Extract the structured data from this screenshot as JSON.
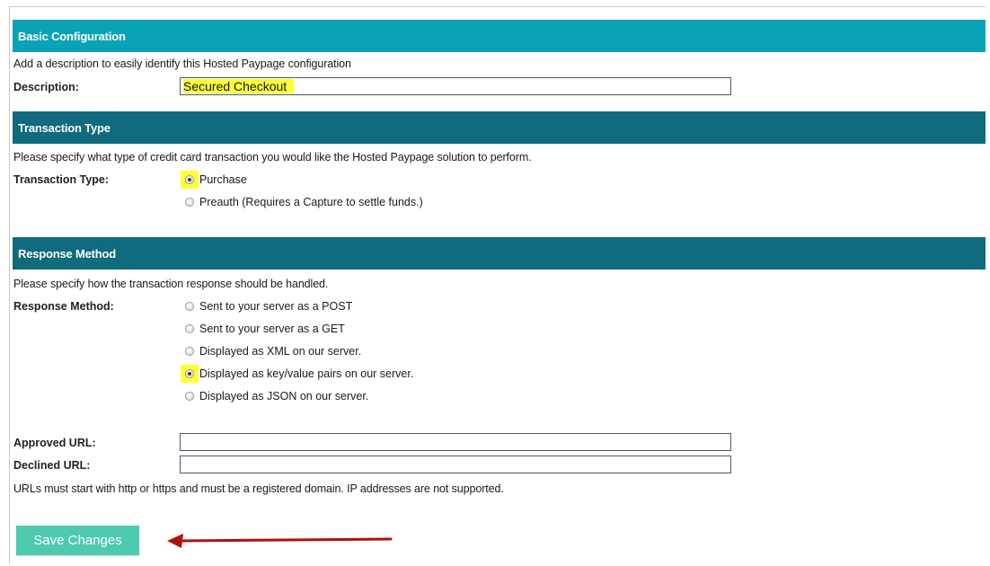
{
  "basic": {
    "header": "Basic Configuration",
    "help": "Add a description to easily identify this Hosted Paypage configuration",
    "description_label": "Description:",
    "description_value": "Secured Checkout"
  },
  "transaction": {
    "header": "Transaction Type",
    "help": "Please specify what type of credit card transaction you would like the Hosted Paypage solution to perform.",
    "label": "Transaction Type:",
    "options": [
      {
        "label": "Purchase",
        "checked": true
      },
      {
        "label": "Preauth (Requires a Capture to settle funds.)",
        "checked": false
      }
    ]
  },
  "response": {
    "header": "Response Method",
    "help": "Please specify how the transaction response should be handled.",
    "label": "Response Method:",
    "options": [
      {
        "label": "Sent to your server as a POST",
        "checked": false
      },
      {
        "label": "Sent to your server as a GET",
        "checked": false
      },
      {
        "label": "Displayed as XML on our server.",
        "checked": false
      },
      {
        "label": "Displayed as key/value pairs on our server.",
        "checked": true
      },
      {
        "label": "Displayed as JSON on our server.",
        "checked": false
      }
    ]
  },
  "urls": {
    "approved_label": "Approved URL:",
    "approved_value": "",
    "declined_label": "Declined URL:",
    "declined_value": "",
    "note": "URLs must start with http or https and must be a registered domain. IP addresses are not supported."
  },
  "actions": {
    "save_label": "Save Changes"
  },
  "colors": {
    "header_light": "#0aa3b5",
    "header_dark": "#0f6b7d",
    "highlight": "#ffff33",
    "button": "#4ecab1",
    "arrow": "#b01010"
  }
}
